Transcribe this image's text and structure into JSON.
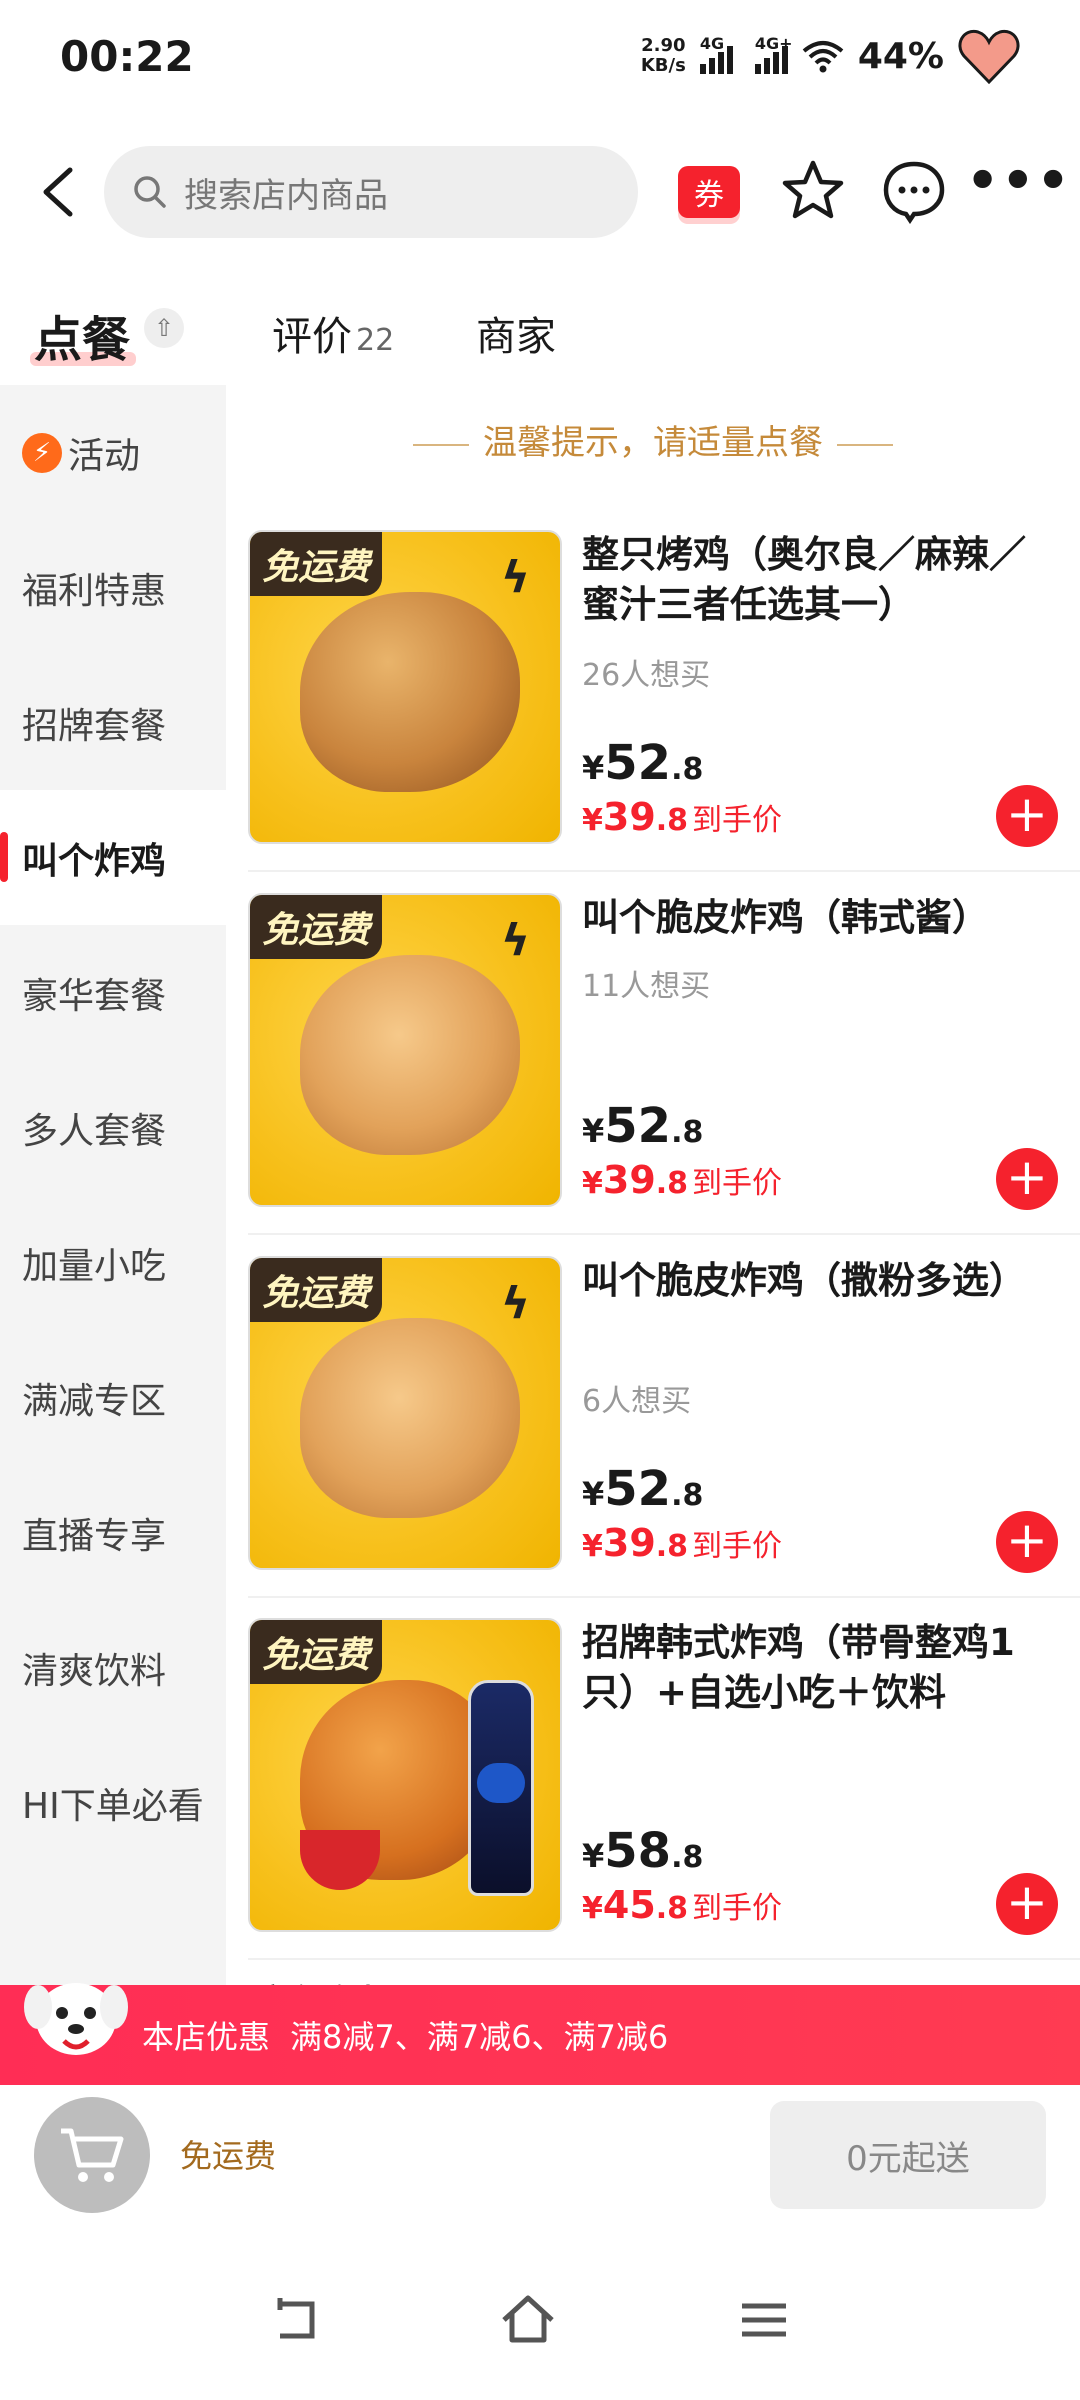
{
  "status_bar": {
    "time": "00:22",
    "speed_value": "2.90",
    "speed_unit": "KB/s",
    "net1": "4G",
    "net2": "4G+",
    "battery": "44%"
  },
  "top_nav": {
    "search_placeholder": "搜索店内商品",
    "coupon_label": "券"
  },
  "tabs": {
    "order": "点餐",
    "review": "评价",
    "review_count": "22",
    "merchant": "商家"
  },
  "sidebar": {
    "items": [
      {
        "label": "活动"
      },
      {
        "label": "福利特惠"
      },
      {
        "label": "招牌套餐"
      },
      {
        "label": "叫个炸鸡"
      },
      {
        "label": "豪华套餐"
      },
      {
        "label": "多人套餐"
      },
      {
        "label": "加量小吃"
      },
      {
        "label": "满减专区"
      },
      {
        "label": "直播专享"
      },
      {
        "label": "清爽饮料"
      },
      {
        "label": "HI下单必看"
      }
    ],
    "active": "叫个炸鸡"
  },
  "hint": "温馨提示，请适量点餐",
  "products": [
    {
      "badge": "免运费",
      "name": "整只烤鸡（奥尔良／麻辣／蜜汁三者任选其一）",
      "want": "26人想买",
      "price_int": "52",
      "price_dec": ".8",
      "deal_int": "39",
      "deal_dec": ".8",
      "deal_label": "到手价"
    },
    {
      "badge": "免运费",
      "name": "叫个脆皮炸鸡（韩式酱）",
      "want": "11人想买",
      "price_int": "52",
      "price_dec": ".8",
      "deal_int": "39",
      "deal_dec": ".8",
      "deal_label": "到手价"
    },
    {
      "badge": "免运费",
      "name": "叫个脆皮炸鸡（撒粉多选）",
      "want": "6人想买",
      "price_int": "52",
      "price_dec": ".8",
      "deal_int": "39",
      "deal_dec": ".8",
      "deal_label": "到手价"
    },
    {
      "badge": "免运费",
      "name": "招牌韩式炸鸡（带骨整鸡1只）+自选小吃＋饮料",
      "want": "",
      "price_int": "58",
      "price_dec": ".8",
      "deal_int": "45",
      "deal_dec": ".8",
      "deal_label": "到手价"
    }
  ],
  "currency": "¥",
  "next_section_peek": "豪华套餐",
  "banner": {
    "title": "本店优惠",
    "offers": "满8减7、满7减6、满7减6"
  },
  "cart": {
    "delivery": "免运费",
    "min_order": "0元起送"
  },
  "colors": {
    "accent": "#f5222d",
    "hint": "#c58a3a",
    "sidebar_bg": "#f4f4f4"
  }
}
